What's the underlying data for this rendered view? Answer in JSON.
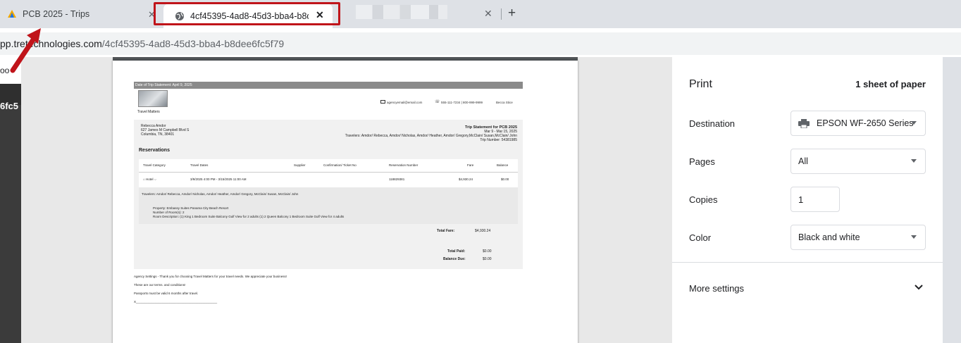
{
  "tabs": {
    "tab1_title": "PCB 2025 - Trips",
    "tab2_title": "4cf45395-4ad8-45d3-bba4-b8d",
    "close_glyph": "✕",
    "new_tab_glyph": "+"
  },
  "address_bar": {
    "url_prefix": "pp.tr",
    "url_host": "e",
    "url_mid": "technologies.com",
    "url_path": "/4cf45395-4ad8-45d3-bba4-b8dee6fc5f79"
  },
  "bookmarks": {
    "partial": "oo"
  },
  "background_page": {
    "partial_text": "6fc5"
  },
  "document": {
    "date_of_statement": "Date of Trip Statement: April 9, 2025",
    "agency_name": "Travel Matters",
    "email": "agencyemail@email.com",
    "phone": "555-111-7234 | 800-999-9999",
    "agent": "Becca Stice",
    "client_name": "Rebecca Amdor",
    "client_address1": "627 James M Campbell Blvd S",
    "client_address2": "Columbia, TN, 38401",
    "trip_title": "Trip Statement for PCB 2025",
    "trip_dates": "Mar 9 - Mar 15, 2025",
    "travelers_line": "Travelers: Amdor/ Rebecca, Amdor/ Nicholas, Amdor/ Heather, Amdor/ Gregory,McClain/ Susan,McClain/ John",
    "trip_number": "Trip Number: 54381985",
    "reservations_heading": "Reservations",
    "columns": [
      "Travel Category",
      "Travel Dates",
      "Supplier",
      "Confirmation/ Ticket No",
      "Reservation Number",
      "Fare",
      "Balance"
    ],
    "row": {
      "category": "Hotel",
      "dates": "3/9/2025 4:00 PM - 3/15/2025 11:00 AM",
      "reservation_number": "118829381",
      "fare": "$4,930.24",
      "balance": "$0.00"
    },
    "row_travelers": "Travelers: Amdor/ Rebecca, Amdor/ Nicholas, Amdor/ Heather, Amdor/ Gregory, McClain/ Susan, McClain/ John",
    "property": "Property: Embassy Suites Panama City Beach Resort",
    "rooms": "Number of Room(s): 2",
    "room_description": "Room Description: (1) King 1 Bedroom Suite Balcony Gulf View for 2 adults (1) 2 Queen Balcony 1 Bedroom Suite Gulf View for 4 adults",
    "total_fare_label": "Total Fare:",
    "total_fare": "$4,930.24",
    "total_paid_label": "Total Paid:",
    "total_paid": "$0.00",
    "balance_due_label": "Balance Due:",
    "balance_due": "$0.00",
    "footer_settings": "Agency Settings - Thank you for choosing Travel Matters for your travel needs. We appreciate your business!",
    "footer_terms": "These are our terms. and conditions!",
    "footer_passports": "Passports must be valid 6 months after travel.",
    "footer_signature": "X______________________________________________"
  },
  "print_panel": {
    "title": "Print",
    "sheet_count": "1 sheet of paper",
    "destination_label": "Destination",
    "destination_value": "EPSON WF-2650 Series",
    "pages_label": "Pages",
    "pages_value": "All",
    "copies_label": "Copies",
    "copies_value": "1",
    "color_label": "Color",
    "color_value": "Black and white",
    "more_settings_label": "More settings"
  },
  "colors": {
    "annotation_red": "#c0141a",
    "tab_strip": "#dee1e6",
    "preview_bg": "#e8e8e8"
  }
}
